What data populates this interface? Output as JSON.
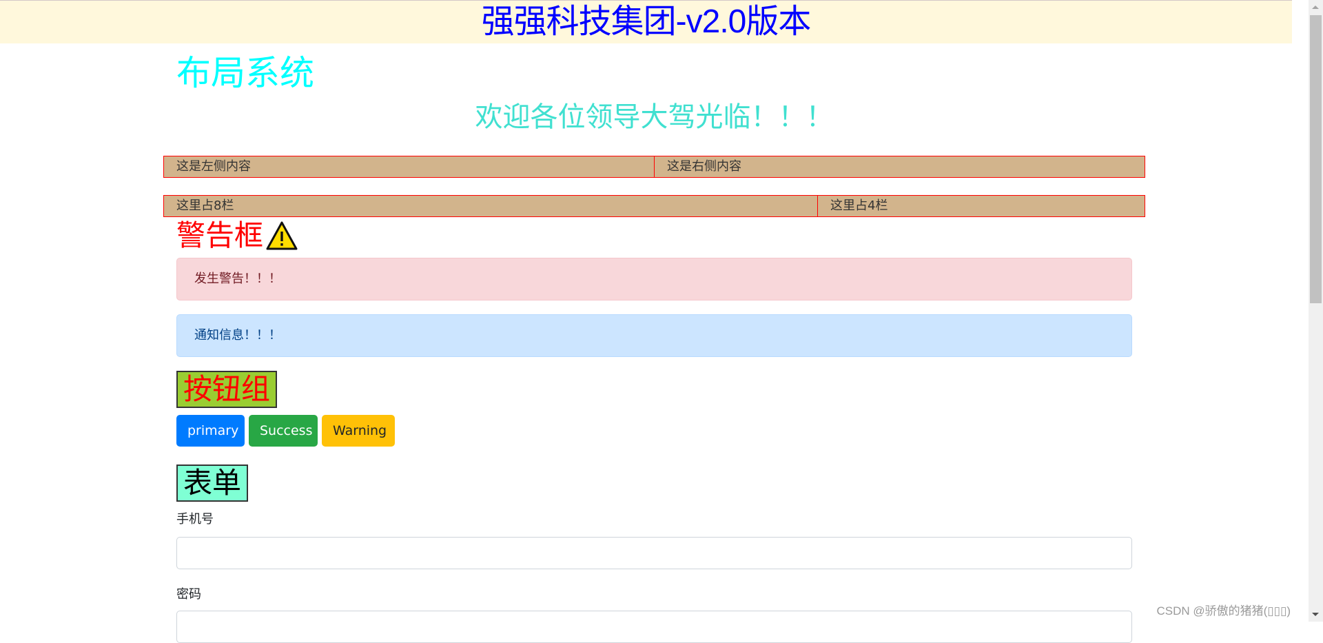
{
  "header": {
    "title": "强强科技集团-v2.0版本"
  },
  "layout": {
    "title": "布局系统",
    "welcome": "欢迎各位领导大驾光临！！！"
  },
  "grid": {
    "row1": {
      "left": "这是左侧内容",
      "right": "这是右侧内容"
    },
    "row2": {
      "col8": "这里占8栏",
      "col4": "这里占4栏"
    }
  },
  "alerts": {
    "heading": "警告框",
    "heading_icon": "warning-triangle-icon",
    "danger": "发生警告！！！",
    "info": "通知信息！！！"
  },
  "buttons": {
    "heading": "按钮组",
    "primary": "primary",
    "success": "Success",
    "warning": "Warning"
  },
  "form": {
    "heading": "表单",
    "phone_label": "手机号",
    "phone_value": "",
    "password_label": "密码",
    "password_value": ""
  },
  "watermark": "CSDN @骄傲的猪猪(▯▯▯)",
  "colors": {
    "header_bg": "#fff8dc",
    "header_text": "#0000ff",
    "layout_title": "#00ffff",
    "welcome_text": "#40e0d0",
    "grid_bg": "#d2b48c",
    "grid_border": "#ff0000",
    "warn_heading": "#ff0000",
    "btn_heading_bg": "#9acd32",
    "form_heading_bg": "#7fffd4"
  }
}
